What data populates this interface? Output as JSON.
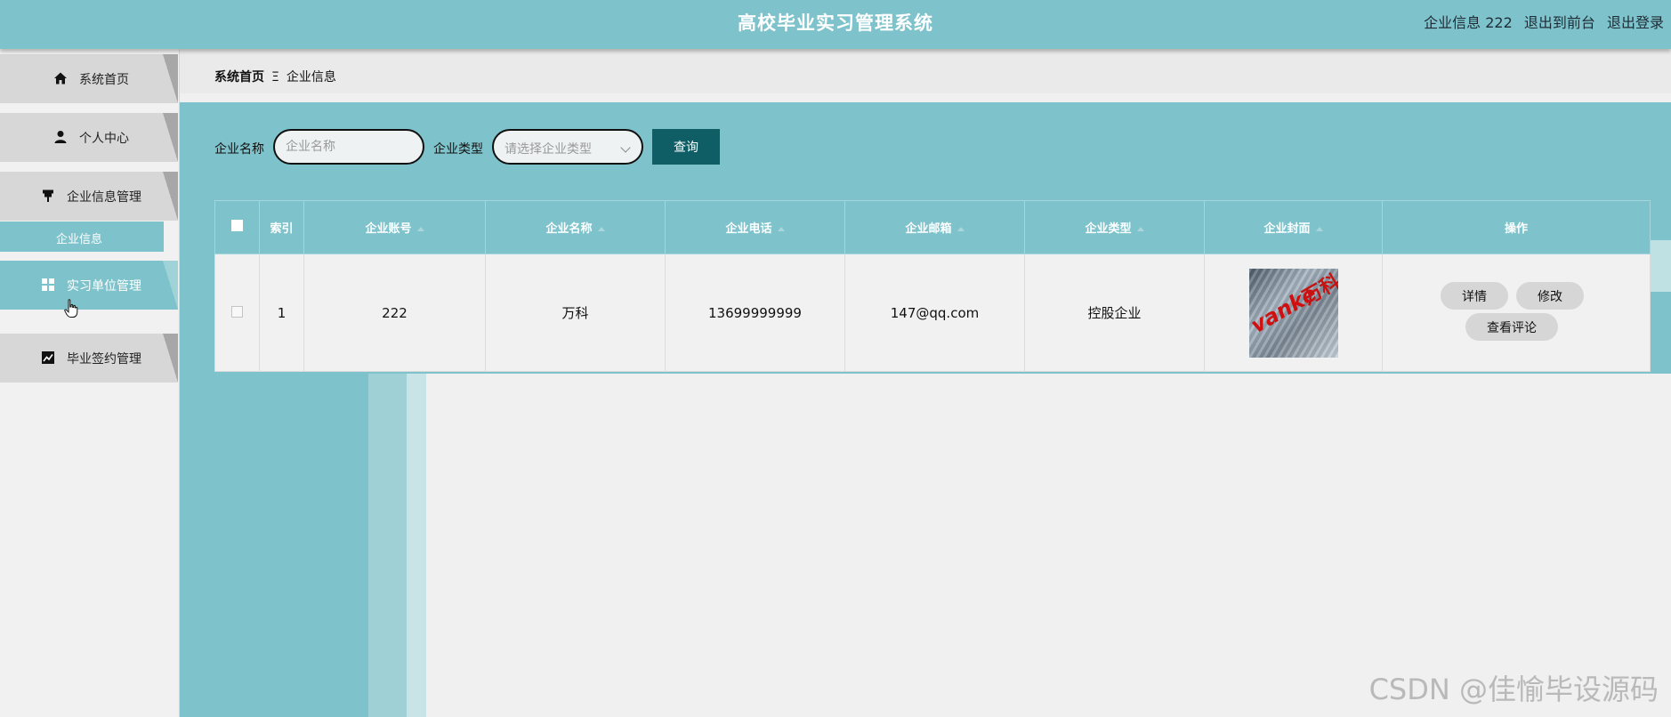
{
  "header": {
    "title": "高校毕业实习管理系统",
    "user_label": "企业信息 222",
    "front_link": "退出到前台",
    "logout_link": "退出登录"
  },
  "sidebar": {
    "items": [
      {
        "label": "系统首页",
        "icon": "home-icon"
      },
      {
        "label": "个人中心",
        "icon": "user-icon"
      },
      {
        "label": "企业信息管理",
        "icon": "pin-icon"
      },
      {
        "label": "实习单位管理",
        "icon": "grid-icon"
      },
      {
        "label": "毕业签约管理",
        "icon": "chart-icon"
      }
    ],
    "submenu": {
      "label": "企业信息"
    }
  },
  "breadcrumb": {
    "home": "系统首页",
    "separator": "Ξ",
    "current": "企业信息"
  },
  "search": {
    "name_label": "企业名称",
    "name_placeholder": "企业名称",
    "type_label": "企业类型",
    "type_placeholder": "请选择企业类型",
    "query_button": "查询"
  },
  "table": {
    "headers": [
      "索引",
      "企业账号",
      "企业名称",
      "企业电话",
      "企业邮箱",
      "企业类型",
      "企业封面",
      "操作"
    ],
    "rows": [
      {
        "index": "1",
        "account": "222",
        "name": "万科",
        "phone": "13699999999",
        "email": "147@qq.com",
        "type": "控股企业",
        "cover_text_latin": "vanke",
        "cover_text_cn": "万科"
      }
    ],
    "actions": {
      "detail": "详情",
      "edit": "修改",
      "comments": "查看评论"
    }
  },
  "watermark": "CSDN @佳愉毕设源码",
  "colors": {
    "header_bg": "#7ec3cb",
    "primary_button": "#0f5e66",
    "sidebar_item": "#d7d7d7",
    "sidebar_active": "#7ec3cb"
  }
}
